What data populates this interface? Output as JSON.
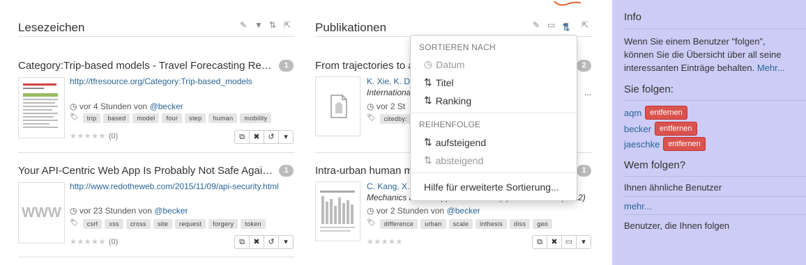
{
  "bookmarks": {
    "title": "Lesezeichen",
    "posts": [
      {
        "title": "Category:Trip-based models - Travel Forecasting Reso...",
        "count": "1",
        "url": "http://tfresource.org/Category:Trip-based_models",
        "time": "vor 4 Stunden von",
        "user": "@becker",
        "tags": [
          "trip",
          "based",
          "model",
          "four",
          "step",
          "human",
          "mobility"
        ],
        "rating": "(0)"
      },
      {
        "title": "Your API-Centric Web App Is Probably Not Safe Agains...",
        "count": "1",
        "url": "http://www.redotheweb.com/2015/11/09/api-security.html",
        "time": "vor 23 Stunden von",
        "user": "@becker",
        "tags": [
          "csrf",
          "xss",
          "cross",
          "site",
          "request",
          "forgery",
          "token"
        ],
        "rating": "(0)",
        "thumb_text": "WWW"
      }
    ]
  },
  "publications": {
    "title": "Publikationen",
    "posts": [
      {
        "title": "From trajectories to a",
        "count": "2",
        "authors": "K. Xie, K. D",
        "journal": "Internationa",
        "time": "vor 2 St",
        "tags": [
          "citedby:"
        ],
        "ellipsis": "..."
      },
      {
        "title": "Intra-urban human m",
        "count": "1",
        "authors": "C. Kang, X.",
        "journal_tail": "l",
        "journal_line2": "Mechanics and its Applications 391 (4): 1702 - 1717 (2012)",
        "time": "vor 2 Stunden von",
        "user": "@becker",
        "tags": [
          "difference",
          "urban",
          "scale",
          "inthesis",
          "diss",
          "geo"
        ]
      }
    ]
  },
  "sort_menu": {
    "header_sort": "SORTIEREN NACH",
    "sort_items": [
      {
        "label": "Datum",
        "disabled": true
      },
      {
        "label": "Titel",
        "disabled": false
      },
      {
        "label": "Ranking",
        "disabled": false
      }
    ],
    "header_order": "REIHENFOLGE",
    "order_items": [
      {
        "label": "aufsteigend",
        "disabled": false
      },
      {
        "label": "absteigend",
        "disabled": true
      }
    ],
    "help": "Hilfe für erweiterte Sortierung..."
  },
  "sidebar": {
    "info_title": "Info",
    "info_text": "Wenn Sie einem Benutzer \"folgen\", können Sie die Übersicht über all seine interessanten Einträge behalten.",
    "info_more": "Mehr...",
    "following_title": "Sie folgen:",
    "following": [
      {
        "user": "aqm",
        "action": "entfernen"
      },
      {
        "user": "becker",
        "action": "entfernen"
      },
      {
        "user": "jaeschke",
        "action": "entfernen"
      }
    ],
    "whom_title": "Wem folgen?",
    "similar": "Ihnen ähnliche Benutzer",
    "more": "mehr...",
    "followers": "Benutzer, die Ihnen folgen"
  },
  "colors": {
    "accent": "#2a6496",
    "sidebar_bg": "#ccccf6",
    "danger": "#d9534f"
  }
}
